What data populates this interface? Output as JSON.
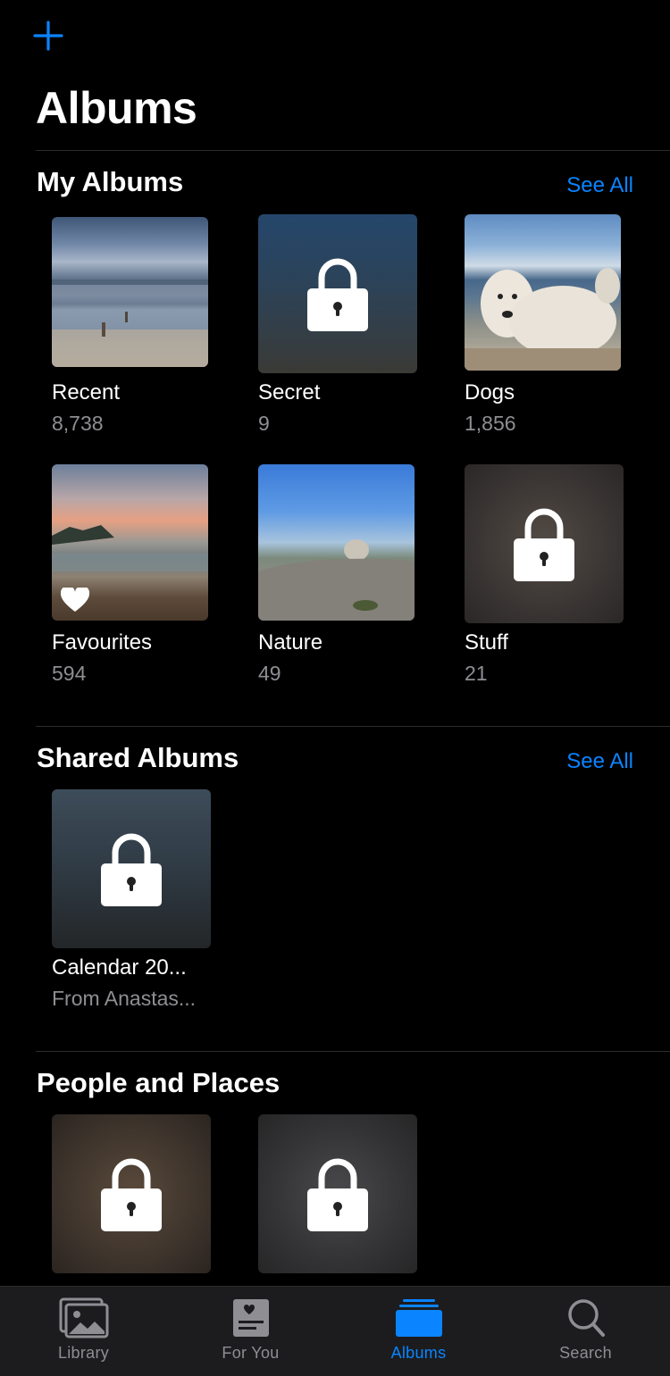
{
  "header": {
    "title": "Albums"
  },
  "my_albums": {
    "title": "My Albums",
    "see_all": "See All",
    "albums": [
      {
        "name": "Recent",
        "count": "8,738",
        "thumb": "photo-beach"
      },
      {
        "name": "Secret",
        "count": "9",
        "thumb": "lock-icon"
      },
      {
        "name": "Dogs",
        "count": "1,856",
        "thumb": "photo-dog"
      },
      {
        "name": "Favourites",
        "count": "594",
        "thumb": "photo-sunset"
      },
      {
        "name": "Nature",
        "count": "49",
        "thumb": "photo-rocks"
      },
      {
        "name": "Stuff",
        "count": "21",
        "thumb": "lock-icon"
      }
    ]
  },
  "shared_albums": {
    "title": "Shared Albums",
    "see_all": "See All",
    "albums": [
      {
        "name": "Calendar 20...",
        "subtitle": "From Anastas...",
        "thumb": "lock-icon"
      }
    ]
  },
  "people_places": {
    "title": "People and Places",
    "albums": [
      {
        "thumb": "lock-icon"
      },
      {
        "thumb": "lock-icon"
      }
    ]
  },
  "tabbar": {
    "tabs": [
      {
        "label": "Library",
        "icon": "photo-library-icon"
      },
      {
        "label": "For You",
        "icon": "for-you-icon"
      },
      {
        "label": "Albums",
        "icon": "albums-icon",
        "active": true
      },
      {
        "label": "Search",
        "icon": "search-icon"
      }
    ]
  },
  "colors": {
    "accent": "#0a84ff",
    "background": "#000000",
    "secondary_text": "#8e8e93",
    "tabbar": "#1c1c1e"
  }
}
